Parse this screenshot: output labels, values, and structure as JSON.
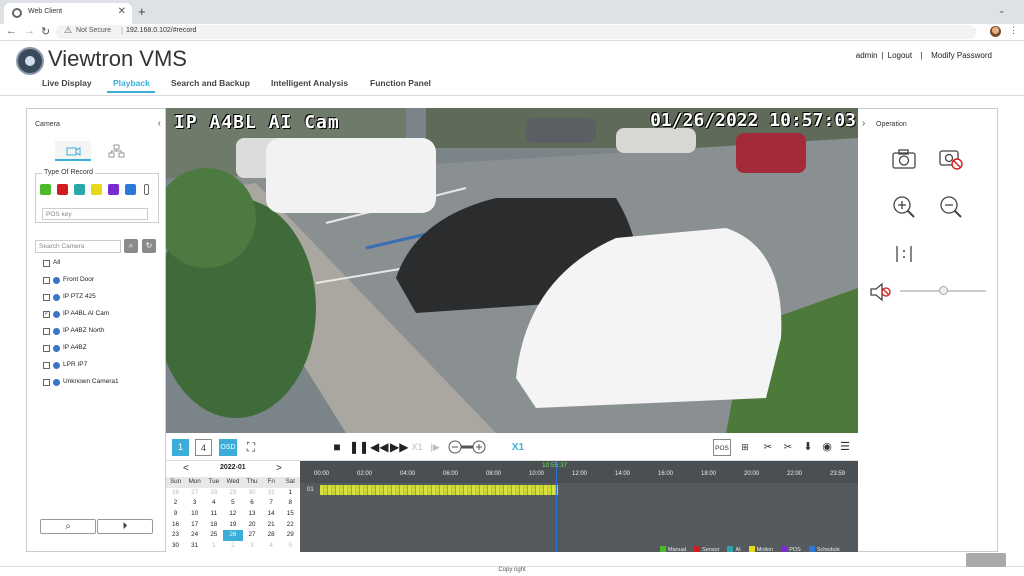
{
  "browser": {
    "tab_title": "Web Client",
    "security_label": "Not Secure",
    "url": "192.168.0.102/#record"
  },
  "app": {
    "brand": "Viewtron VMS",
    "user_links": {
      "user": "admin",
      "logout": "Logout",
      "sep": "|",
      "modify_password": "Modify Password"
    },
    "nav": [
      "Live Display",
      "Playback",
      "Search and Backup",
      "Intelligent Analysis",
      "Function Panel"
    ],
    "active_nav": "Playback"
  },
  "left_panel": {
    "title": "Camera",
    "type_of_record_label": "Type Of Record",
    "record_types": [
      {
        "name": "Manual",
        "color": "#4cbb2a"
      },
      {
        "name": "Sensor",
        "color": "#d01d1d"
      },
      {
        "name": "AI",
        "color": "#2aa8a8"
      },
      {
        "name": "Motion",
        "color": "#e8d81a"
      },
      {
        "name": "POS",
        "color": "#7a2ad0"
      },
      {
        "name": "Schedule",
        "color": "#2a7ad8"
      }
    ],
    "pos_key_placeholder": "POS key",
    "search_placeholder": "Search Camera",
    "all_label": "All",
    "cameras": [
      {
        "name": "Front Door",
        "checked": false
      },
      {
        "name": "IP PTZ 425",
        "checked": false
      },
      {
        "name": "IP A4BL AI Cam",
        "checked": true
      },
      {
        "name": "IP A4BZ North",
        "checked": false
      },
      {
        "name": "IP A4BZ",
        "checked": false
      },
      {
        "name": "LPR IP7",
        "checked": false
      },
      {
        "name": "Unknown Camera1",
        "checked": false
      }
    ]
  },
  "video": {
    "osd_camera": "IP A4BL AI Cam",
    "osd_datetime": "01/26/2022 10:57:03"
  },
  "right_panel": {
    "title": "Operation"
  },
  "controls": {
    "split_1": "1",
    "split_4": "4",
    "osd": "OSD",
    "speed_disabled": "X1",
    "speed": "X1",
    "pos": "POS"
  },
  "calendar": {
    "month": "2022-01",
    "weekdays": [
      "Sun",
      "Mon",
      "Tue",
      "Wed",
      "Thu",
      "Fri",
      "Sat"
    ],
    "weeks": [
      [
        "26",
        "27",
        "28",
        "29",
        "30",
        "31",
        "1"
      ],
      [
        "2",
        "3",
        "4",
        "5",
        "6",
        "7",
        "8"
      ],
      [
        "9",
        "10",
        "11",
        "12",
        "13",
        "14",
        "15"
      ],
      [
        "16",
        "17",
        "18",
        "19",
        "20",
        "21",
        "22"
      ],
      [
        "23",
        "24",
        "25",
        "26",
        "27",
        "28",
        "29"
      ],
      [
        "30",
        "31",
        "1",
        "2",
        "3",
        "4",
        "5"
      ]
    ],
    "selected": "26"
  },
  "timeline": {
    "current_time": "10:55:37",
    "ticks": [
      "00:00",
      "02:00",
      "04:00",
      "06:00",
      "08:00",
      "10:00",
      "12:00",
      "14:00",
      "16:00",
      "18:00",
      "20:00",
      "22:00",
      "23:59"
    ],
    "channel": "01",
    "legend": [
      {
        "name": "Manual",
        "color": "#4cbb2a"
      },
      {
        "name": "Sensor",
        "color": "#d01d1d"
      },
      {
        "name": "AI",
        "color": "#2aa8a8"
      },
      {
        "name": "Motion",
        "color": "#e8d81a"
      },
      {
        "name": "POS",
        "color": "#7a2ad0"
      },
      {
        "name": "Schedule",
        "color": "#2a7ad8"
      }
    ]
  },
  "footer": {
    "copyright": "Copy right"
  }
}
